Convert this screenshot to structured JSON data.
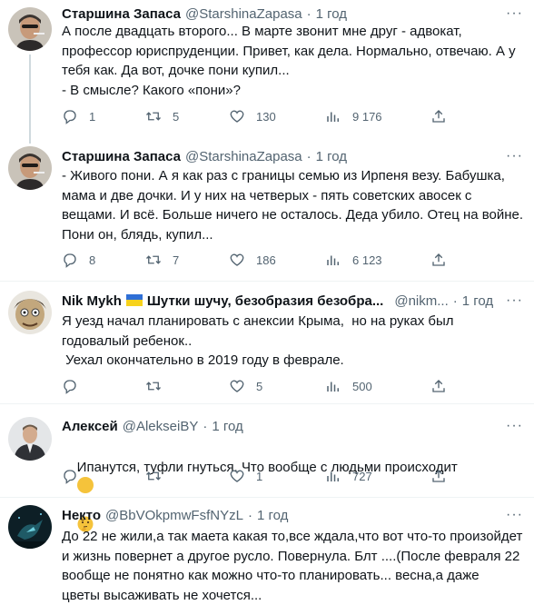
{
  "more_label": "···",
  "tweets": [
    {
      "name": "Старшина Запаса",
      "handle": "@StarshinaZapasa",
      "dot": "·",
      "time": "1 год",
      "text": "А после двадцать второго... В марте звонит мне друг - адвокат,\nпрофессор юриспруденции. Привет, как дела. Нормально, отвечаю. А у\nтебя как. Да вот, дочке пони купил...\n- В смысле? Какого «пони»?",
      "replies": "1",
      "retweets": "5",
      "likes": "130",
      "views": "9 176"
    },
    {
      "name": "Старшина Запаса",
      "handle": "@StarshinaZapasa",
      "dot": "·",
      "time": "1 год",
      "text": "- Живого пони. А я как раз с границы семью из Ирпеня везу. Бабушка,\nмама и две дочки. И у них на четверых - пять советских авосек с\nвещами. И всё. Больше ничего не осталось. Деда убило. Отец на войне.\nПони он, блядь, купил...",
      "replies": "8",
      "retweets": "7",
      "likes": "186",
      "views": "6 123"
    },
    {
      "name": "Nik Mykh",
      "name2": "Шутки шучу, безобразия безобра...",
      "handle": "@nikm...",
      "dot": "·",
      "time": "1 год",
      "text": "Я уезд начал планировать с анексии Крыма,  но на руках был\nгодовалый ребенок..\n Уехал окончательно в 2019 году в феврале.",
      "replies": "",
      "retweets": "",
      "likes": "5",
      "views": "500"
    },
    {
      "name": "Алексей",
      "handle": "@AlekseiBY",
      "dot": "·",
      "time": "1 год",
      "text": "Ипанутся, туфли гнуться. Что вообще с людьми происходит",
      "emoji": "thinking-face-emoji",
      "replies": "",
      "retweets": "",
      "likes": "1",
      "views": "727"
    },
    {
      "name": "Некто",
      "handle": "@BbVOkpmwFsfNYzL",
      "dot": "·",
      "time": "1 год",
      "text": "До 22 не жили,а так маета какая то,все ждала,что вот что-то произойдет\nи жизнь повернет а другое русло. Повернула. Блт ....(После февраля 22\nвообще не понятно как можно что-то планировать... весна,а даже\nцветы высаживать не хочется..."
    }
  ],
  "colors": {
    "text": "#0f1419",
    "muted": "#536471",
    "divider": "#eff3f4",
    "thread": "#cfd9de",
    "flag_blue": "#2f6fd6",
    "flag_yellow": "#f7d21c"
  }
}
